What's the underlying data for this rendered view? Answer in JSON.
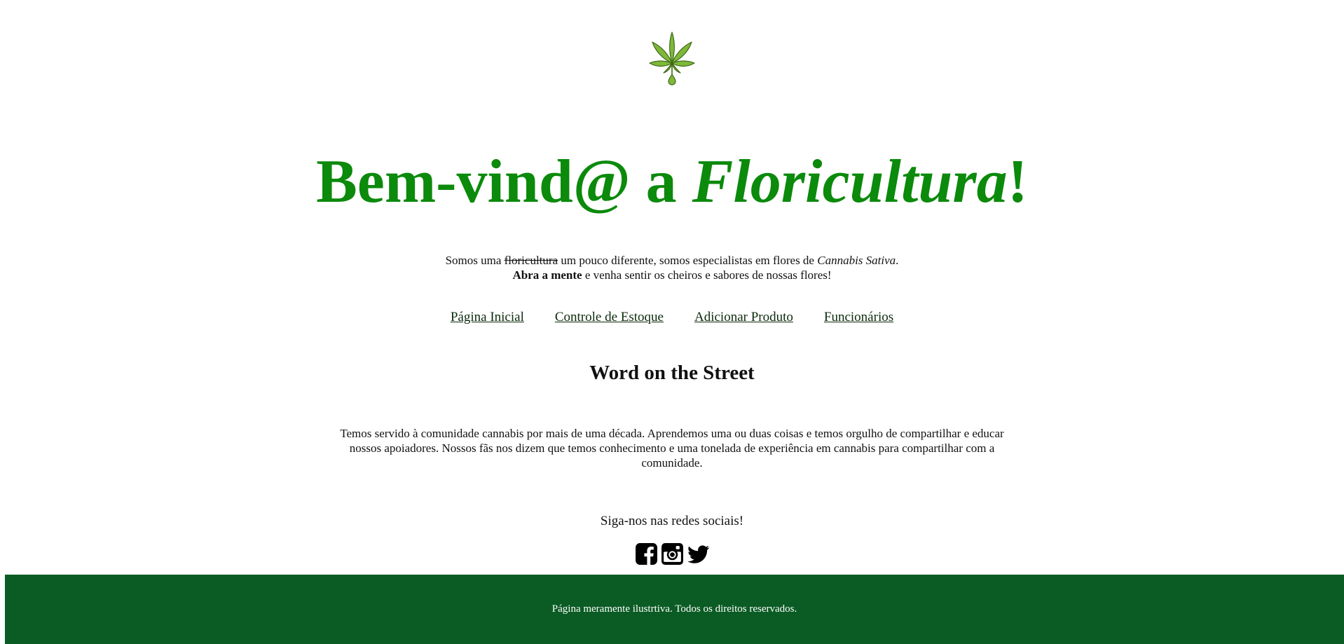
{
  "header": {
    "logo_icon": "cannabis-leaf-icon",
    "title_prefix": "Bem-vind@ a ",
    "title_emphasis": "Floricultura",
    "title_suffix": "!"
  },
  "intro": {
    "part1": "Somos uma ",
    "struck": "floricultura",
    "part2": " um pouco diferente, somos especialistas em flores de ",
    "species": "Cannabis Sativa",
    "part3": ".",
    "bold": "Abra a mente",
    "part4": " e venha sentir os cheiros e sabores de nossas flores!"
  },
  "nav": {
    "home": "Página Inicial",
    "stock": "Controle de Estoque",
    "add_product": "Adicionar Produto",
    "staff": "Funcionários"
  },
  "section": {
    "title": "Word on the Street",
    "body": "Temos servido à comunidade cannabis por mais de uma década. Aprendemos uma ou duas coisas e temos orgulho de compartilhar e educar nossos apoiadores. Nossos fãs nos dizem que temos conhecimento e uma tonelada de experiência em cannabis para compartilhar com a comunidade."
  },
  "social": {
    "heading": "Siga-nos nas redes sociais!",
    "icons": [
      "facebook-icon",
      "instagram-icon",
      "twitter-icon"
    ]
  },
  "footer": {
    "text": "Página meramente ilustrtiva. Todos os direitos reservados."
  },
  "colors": {
    "title": "#0b8a0b",
    "footer_bg": "#0b5b24",
    "leaf": "#7fb83a",
    "nav_link": "#0c2a0c"
  }
}
